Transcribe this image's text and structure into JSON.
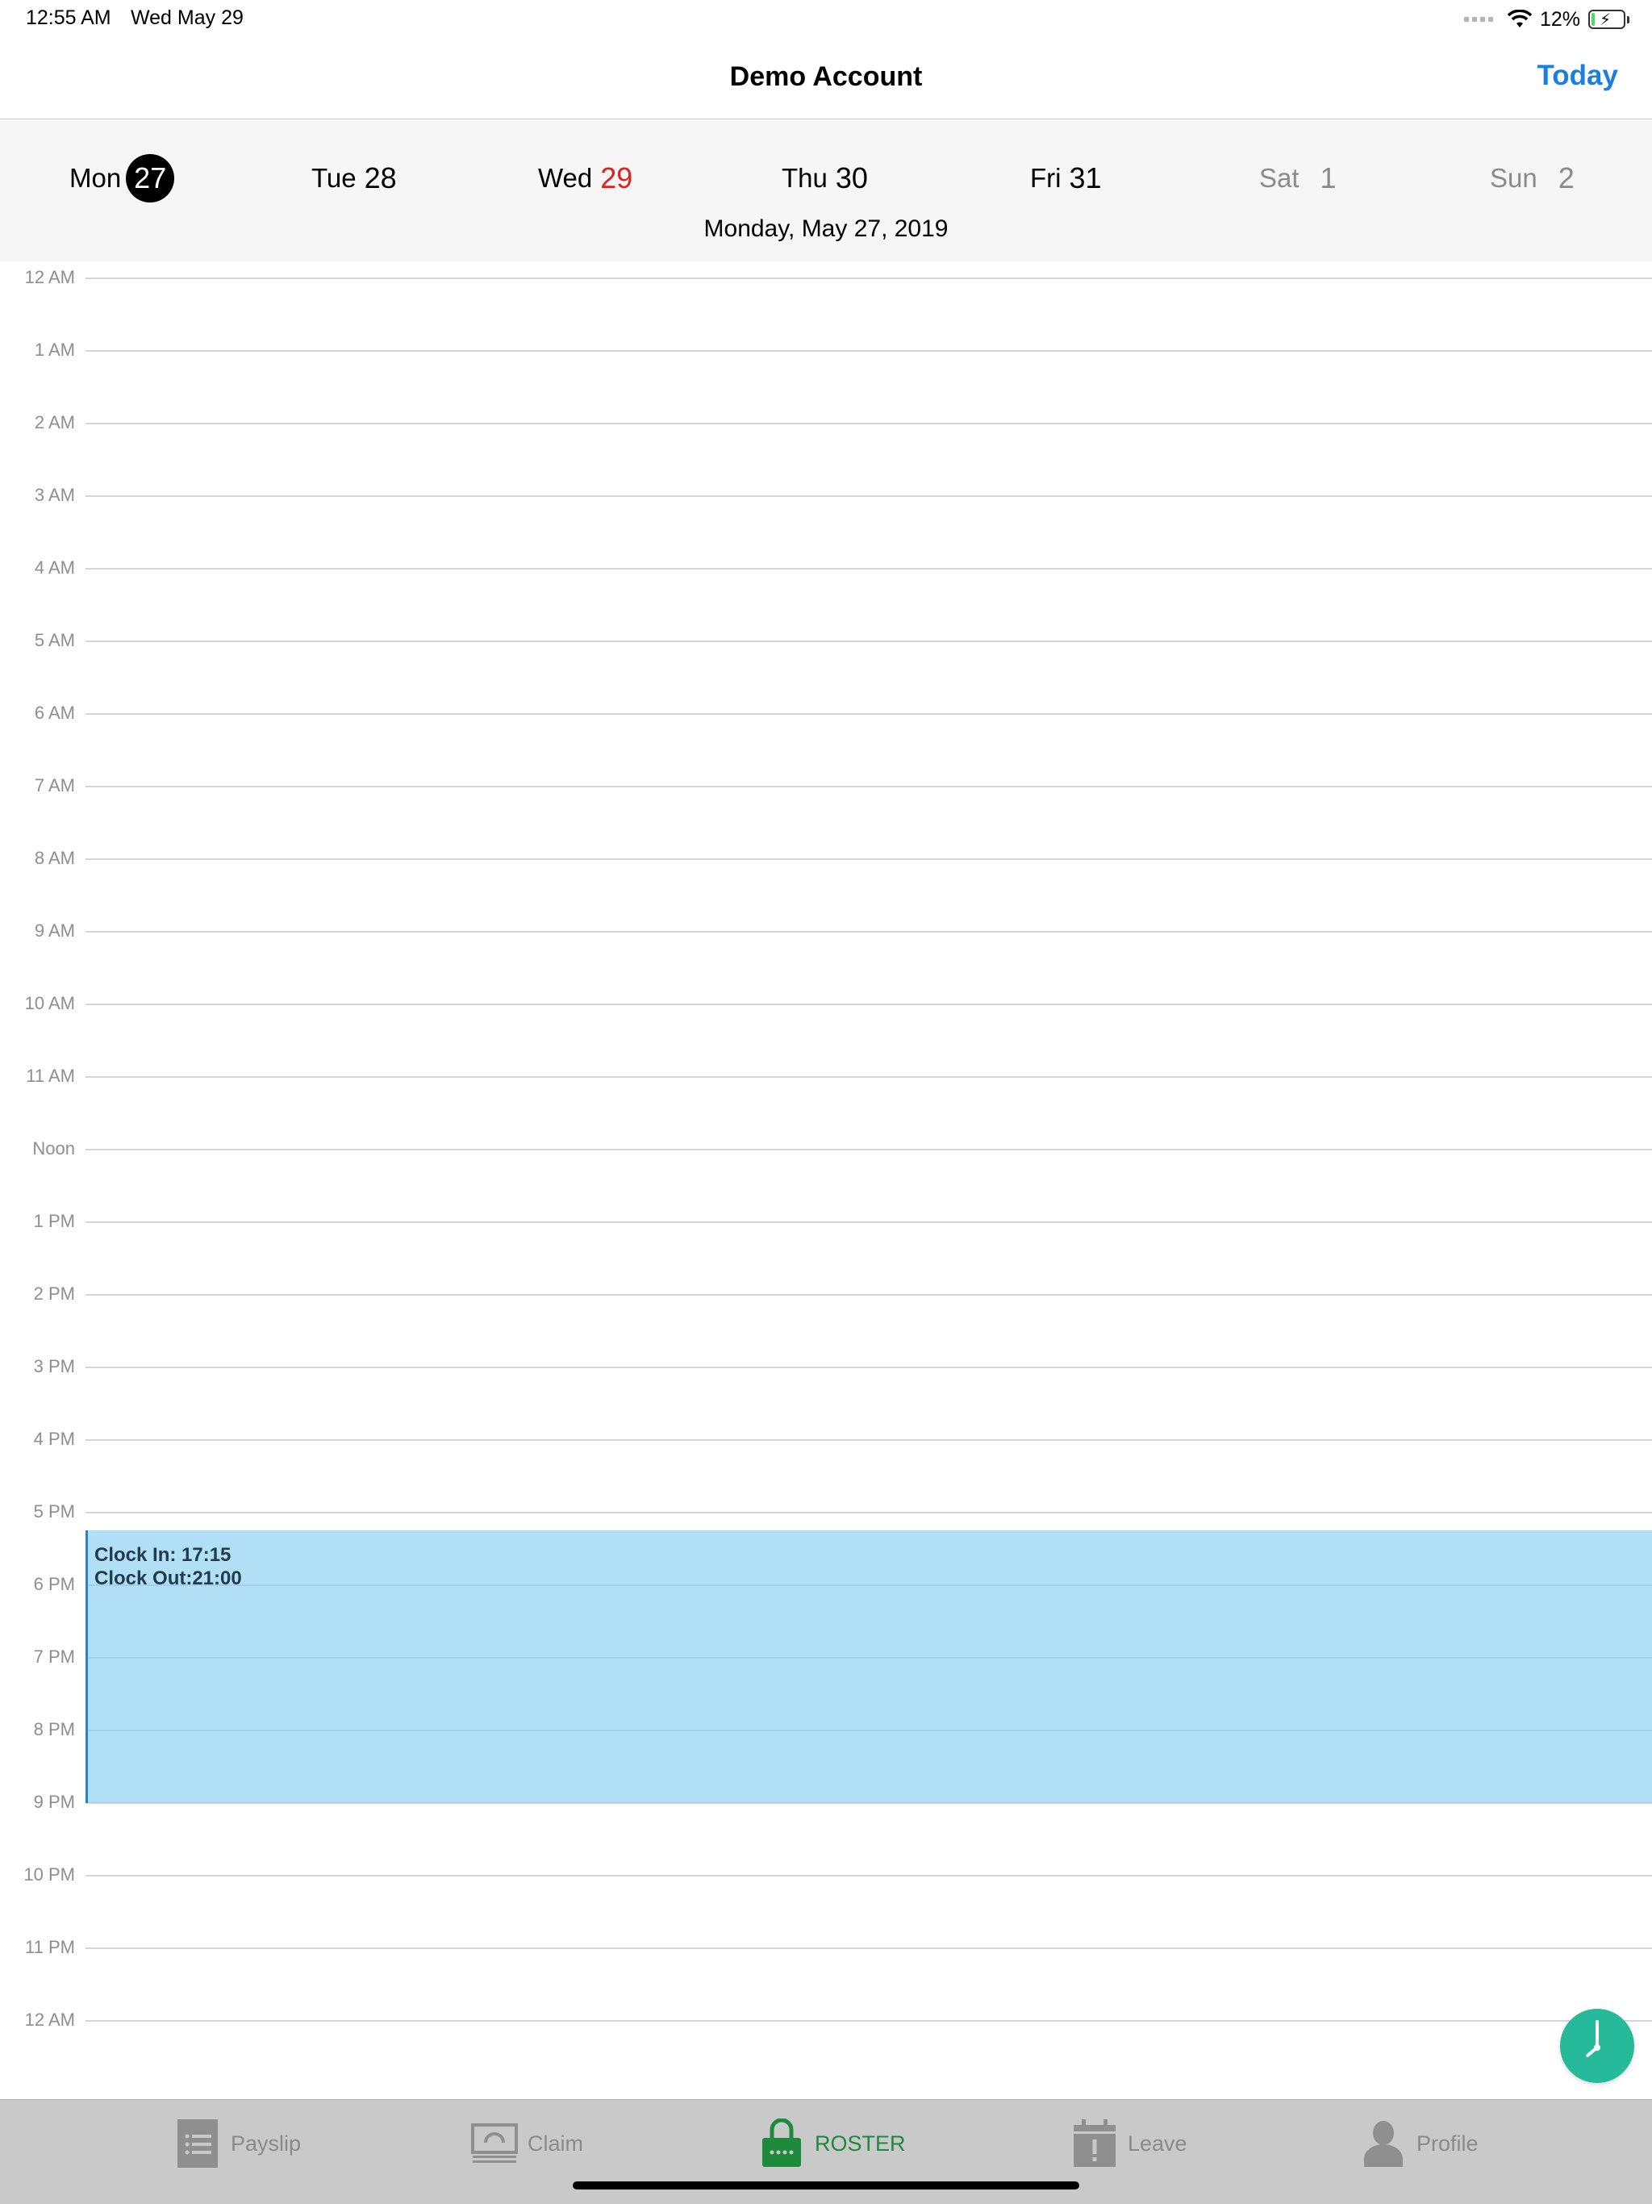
{
  "status_bar": {
    "time": "12:55 AM",
    "date": "Wed May 29",
    "battery": "12%"
  },
  "nav": {
    "title": "Demo Account",
    "today_label": "Today"
  },
  "week": {
    "days": [
      {
        "name": "Mon",
        "num": "27"
      },
      {
        "name": "Tue",
        "num": "28"
      },
      {
        "name": "Wed",
        "num": "29"
      },
      {
        "name": "Thu",
        "num": "30"
      },
      {
        "name": "Fri",
        "num": "31"
      },
      {
        "name": "Sat",
        "num": "1"
      },
      {
        "name": "Sun",
        "num": "2"
      }
    ],
    "selected_index": 0,
    "today_index": 2,
    "selected_date_label": "Monday, May 27, 2019"
  },
  "timeline": {
    "hours": [
      "12 AM",
      "1 AM",
      "2 AM",
      "3 AM",
      "4 AM",
      "5 AM",
      "6 AM",
      "7 AM",
      "8 AM",
      "9 AM",
      "10 AM",
      "11 AM",
      "Noon",
      "1 PM",
      "2 PM",
      "3 PM",
      "4 PM",
      "5 PM",
      "6 PM",
      "7 PM",
      "8 PM",
      "9 PM",
      "10 PM",
      "11 PM",
      "12 AM"
    ],
    "event": {
      "clock_in": "Clock In: 17:15",
      "clock_out": "Clock Out:21:00"
    }
  },
  "tabs": [
    {
      "label": "Payslip",
      "icon": "payslip-icon"
    },
    {
      "label": "Claim",
      "icon": "claim-icon"
    },
    {
      "label": "ROSTER",
      "icon": "roster-icon"
    },
    {
      "label": "Leave",
      "icon": "leave-icon"
    },
    {
      "label": "Profile",
      "icon": "profile-icon"
    }
  ],
  "colors": {
    "accent": "#1a7fe0",
    "today": "#e0201c",
    "event": "#b3dff4",
    "fab": "#26b99a",
    "active_tab": "#1e8a3c"
  }
}
